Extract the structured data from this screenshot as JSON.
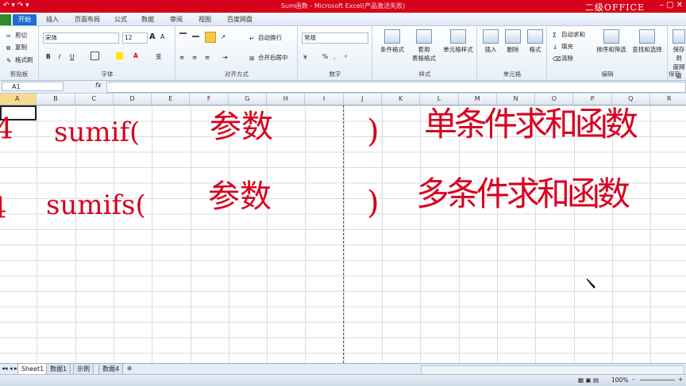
{
  "titlebar": {
    "title": "Sum函数 - Microsoft Excel(产品激活失败)",
    "brand": "二级OFFICE",
    "qat": "↶ ▾ ↷ ▾",
    "window_controls": "– ▢ ✕"
  },
  "tabs": [
    "开始",
    "插入",
    "页面布局",
    "公式",
    "数据",
    "审阅",
    "视图",
    "百度网盘"
  ],
  "file_tab": "",
  "ribbon": {
    "clipboard": {
      "cut": "剪切",
      "copy": "复制",
      "format_painter": "格式刷",
      "label": "剪贴板"
    },
    "font": {
      "name": "宋体",
      "size": "12",
      "label": "字体",
      "bold": "B",
      "italic": "I",
      "underline": "U",
      "grow": "A",
      "shrink": "A",
      "color_a": "A",
      "wen": "变"
    },
    "alignment": {
      "wrap": "自动换行",
      "merge": "合并后居中",
      "label": "对齐方式"
    },
    "number": {
      "format": "常规",
      "percent": "%",
      "comma": ",",
      "label": "数字"
    },
    "styles": {
      "conditional": "条件格式",
      "table": "套用\n表格格式",
      "cell_styles": "单元格样式",
      "label": "样式"
    },
    "cells": {
      "insert": "插入",
      "delete": "删除",
      "format": "格式",
      "label": "单元格"
    },
    "editing": {
      "autosum": "自动求和",
      "fill": "填充",
      "clear": "清除",
      "sort": "排序和筛选",
      "find": "查找和选择",
      "label": "编辑"
    },
    "save": {
      "label": "保存到\n度网盘",
      "group": "保存"
    }
  },
  "formula_bar": {
    "name_box": "A1",
    "fx": "fx",
    "value": ""
  },
  "columns": [
    "A",
    "B",
    "C",
    "D",
    "E",
    "F",
    "G",
    "H",
    "I",
    "J",
    "K",
    "L",
    "M",
    "N",
    "O",
    "P",
    "Q",
    "R"
  ],
  "annotations": {
    "row1_left": "4",
    "row1_func": "sumif(",
    "row1_param": "参数",
    "row1_close": ")",
    "row1_desc": "单条件求和函数",
    "row2_left": "4",
    "row2_func": "sumifs(",
    "row2_param": "参数",
    "row2_close": ")",
    "row2_desc": "多条件求和函数"
  },
  "sheets": [
    "Sheet1",
    "数据1",
    "示例",
    "数据4"
  ],
  "status": {
    "zoom": "100%",
    "minus": "–",
    "plus": "+"
  },
  "colors": {
    "title_bar": "#d6041a",
    "ink": "#d8001e",
    "active_tab": "#1b6fce",
    "selected_header": "#f9d98c"
  }
}
